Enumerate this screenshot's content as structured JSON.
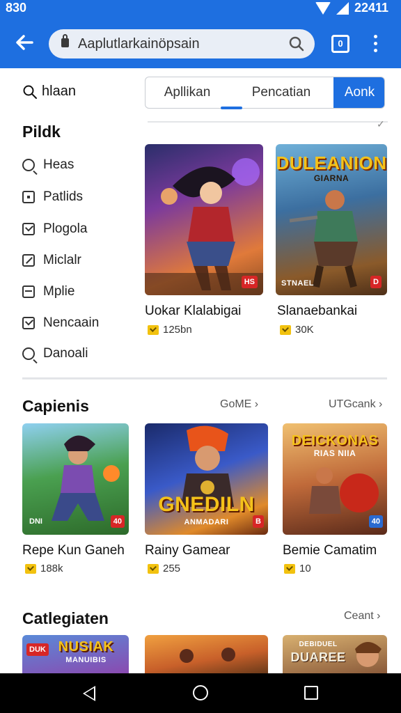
{
  "status_bar": {
    "time": "830",
    "clock": "22411"
  },
  "browser": {
    "url": "Aaplutlarkainöpsain",
    "tab_count": "0"
  },
  "sidebar": {
    "search_label": "hlaan",
    "title": "Pildk",
    "items": [
      {
        "label": "Heas",
        "icon": "search-icon"
      },
      {
        "label": "Patlids",
        "icon": "box-icon"
      },
      {
        "label": "Plogola",
        "icon": "check-icon"
      },
      {
        "label": "Miclalr",
        "icon": "edit-icon"
      },
      {
        "label": "Mplie",
        "icon": "mail-icon"
      },
      {
        "label": "Nencaain",
        "icon": "check-icon"
      },
      {
        "label": "Danoali",
        "icon": "search-icon"
      }
    ]
  },
  "tabs": [
    {
      "label": "Apllikan"
    },
    {
      "label": "Pencatian"
    },
    {
      "label": "Aonk"
    }
  ],
  "featured": [
    {
      "title": "Uokar Klalabigai",
      "meta": "125bn",
      "badge": "HS",
      "art": "warrior-heroine"
    },
    {
      "title": "Slanaebankai",
      "meta": "30K",
      "badge": "D",
      "art_title": "DULEANION",
      "art_subtitle": "GIARNA",
      "art_caption": "STNAEL"
    }
  ],
  "sections": [
    {
      "title": "Capienis",
      "link1": "GoME ›",
      "link2": "UTGcank ›",
      "items": [
        {
          "title": "Repe Kun Ganeh",
          "meta": "188k",
          "badge": "40",
          "badge_left": "DNI"
        },
        {
          "title": "Rainy Gamear",
          "meta": "255",
          "badge": "B",
          "art_title": "GNEDILN",
          "art_subtitle": "ANMADARI"
        },
        {
          "title": "Bemie Camatim",
          "meta": "10",
          "badge": "40",
          "art_title": "DEICKONAS",
          "art_subtitle": "RIAS NIIA"
        }
      ]
    },
    {
      "title": "Catlegiaten",
      "link1": "Ceant ›",
      "items": [
        {
          "art_title": "NUSIAK",
          "art_subtitle": "MANUIBIS",
          "badge": "DUK"
        },
        {
          "art_title": ""
        },
        {
          "art_title": "DUAREE",
          "art_subtitle": "DEBIDUEL"
        }
      ]
    }
  ],
  "colors": {
    "accent": "#1e6fe0",
    "badge": "#d72626",
    "star": "#f2c20f"
  }
}
